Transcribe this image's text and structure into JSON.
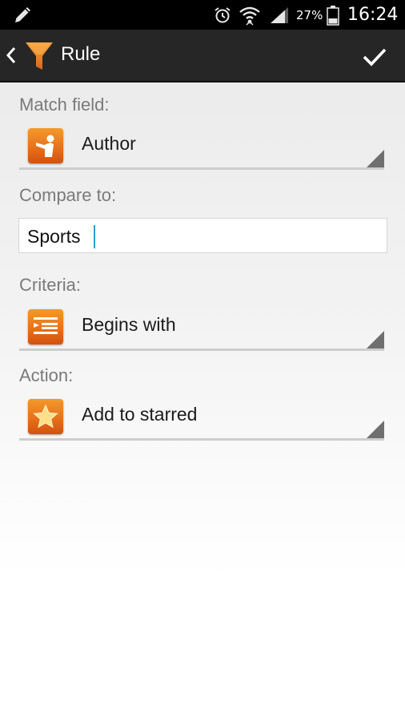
{
  "status_bar": {
    "battery_percent": "27%",
    "time": "16:24",
    "icons": [
      "edit-icon",
      "alarm-icon",
      "wifi-icon",
      "signal-icon",
      "battery-icon"
    ]
  },
  "action_bar": {
    "title": "Rule",
    "back_icon": "chevron-left-icon",
    "app_icon": "funnel-icon",
    "confirm_icon": "check-icon"
  },
  "form": {
    "match_field": {
      "label": "Match field:",
      "value": "Author",
      "icon": "person-icon"
    },
    "compare_to": {
      "label": "Compare to:",
      "value": "Sports"
    },
    "criteria": {
      "label": "Criteria:",
      "value": "Begins with",
      "icon": "indent-list-icon"
    },
    "action": {
      "label": "Action:",
      "value": "Add to starred",
      "icon": "star-icon"
    }
  },
  "colors": {
    "accent_orange": "#e8711a",
    "action_bar": "#262626",
    "cursor_blue": "#2f9bd8",
    "label_gray": "#7a7a7a"
  }
}
